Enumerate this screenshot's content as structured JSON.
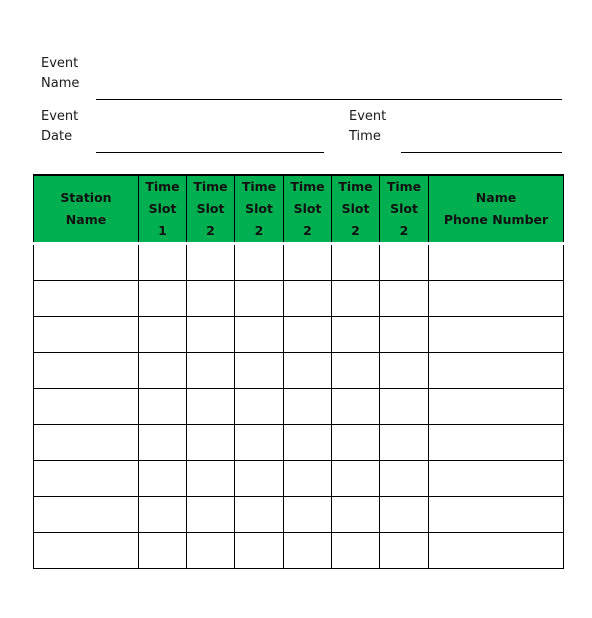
{
  "form": {
    "event_name_label": [
      "Event",
      "Name"
    ],
    "event_date_label": [
      "Event",
      "Date"
    ],
    "event_time_label": [
      "Event",
      "Time"
    ],
    "event_name_value": "",
    "event_date_value": "",
    "event_time_value": ""
  },
  "table": {
    "header_color": "#00b050",
    "columns": [
      {
        "lines": [
          "Station",
          "Name"
        ]
      },
      {
        "lines": [
          "Time",
          "Slot",
          "1"
        ]
      },
      {
        "lines": [
          "Time",
          "Slot",
          "2"
        ]
      },
      {
        "lines": [
          "Time",
          "Slot",
          "2"
        ]
      },
      {
        "lines": [
          "Time",
          "Slot",
          "2"
        ]
      },
      {
        "lines": [
          "Time",
          "Slot",
          "2"
        ]
      },
      {
        "lines": [
          "Time",
          "Slot",
          "2"
        ]
      },
      {
        "lines": [
          "Name",
          "Phone Number"
        ]
      }
    ],
    "rows": [
      [
        "",
        "",
        "",
        "",
        "",
        "",
        "",
        ""
      ],
      [
        "",
        "",
        "",
        "",
        "",
        "",
        "",
        ""
      ],
      [
        "",
        "",
        "",
        "",
        "",
        "",
        "",
        ""
      ],
      [
        "",
        "",
        "",
        "",
        "",
        "",
        "",
        ""
      ],
      [
        "",
        "",
        "",
        "",
        "",
        "",
        "",
        ""
      ],
      [
        "",
        "",
        "",
        "",
        "",
        "",
        "",
        ""
      ],
      [
        "",
        "",
        "",
        "",
        "",
        "",
        "",
        ""
      ],
      [
        "",
        "",
        "",
        "",
        "",
        "",
        "",
        ""
      ],
      [
        "",
        "",
        "",
        "",
        "",
        "",
        "",
        ""
      ]
    ]
  }
}
